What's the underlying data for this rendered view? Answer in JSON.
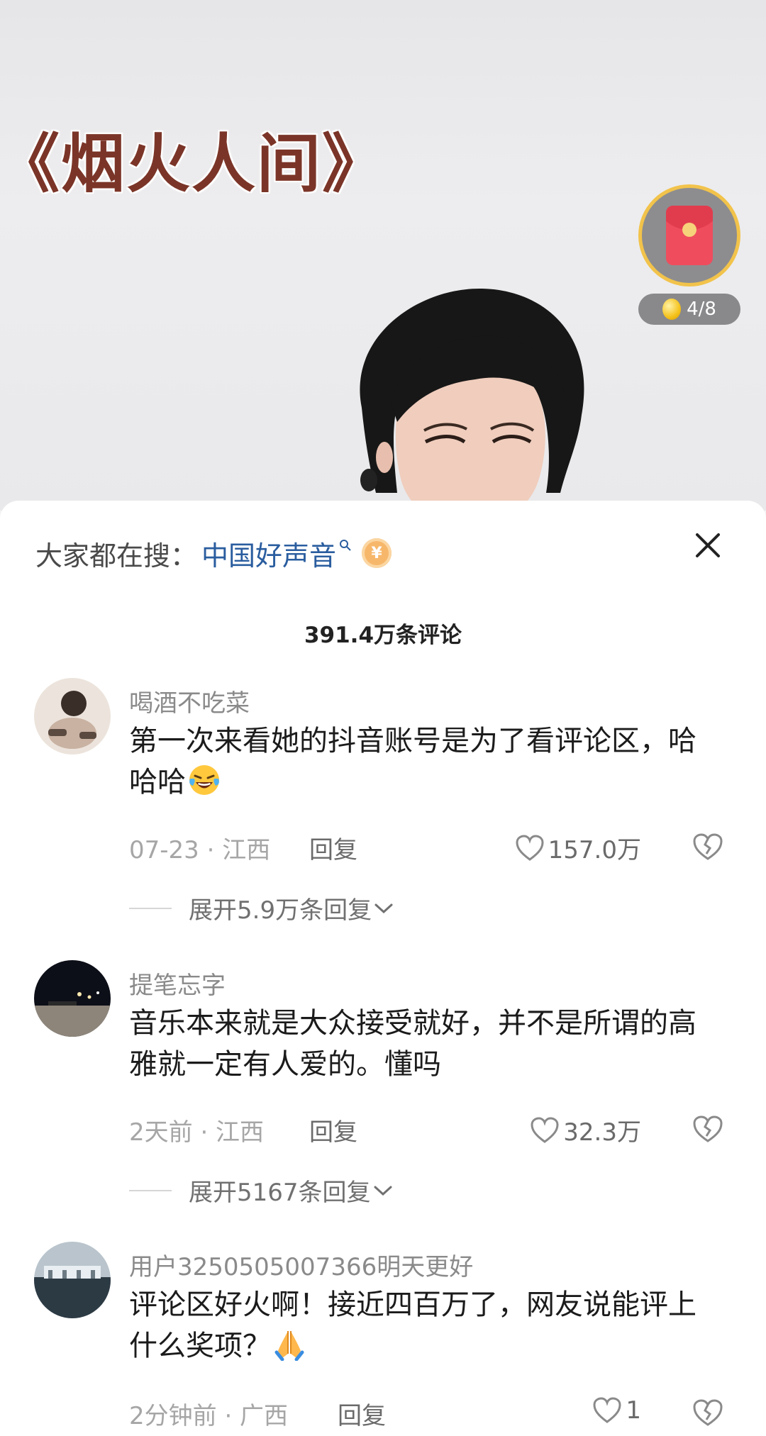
{
  "video": {
    "title_overlay": "《烟火人间》",
    "task_progress": "4/8"
  },
  "sheet": {
    "hot_search_label": "大家都在搜：",
    "hot_search_term": "中国好声音",
    "comment_count": "391.4万条评论"
  },
  "comments": [
    {
      "username": "喝酒不吃菜",
      "text": "第一次来看她的抖音账号是为了看评论区，哈哈哈",
      "emoji": "laughing-tears-emoji",
      "meta": "07-23 · 江西",
      "reply_label": "回复",
      "likes": "157.0万",
      "expand_label": "展开5.9万条回复"
    },
    {
      "username": "提笔忘字",
      "text": "音乐本来就是大众接受就好，并不是所谓的高雅就一定有人爱的。懂吗",
      "meta": "2天前 · 江西",
      "reply_label": "回复",
      "likes": "32.3万",
      "expand_label": "展开5167条回复"
    },
    {
      "username": "用户3250505007366明天更好",
      "text": "评论区好火啊！接近四百万了，网友说能评上什么奖项？",
      "emoji": "praying-hands-emoji",
      "meta": "2分钟前 · 广西",
      "reply_label": "回复",
      "likes": "1"
    }
  ],
  "colors": {
    "link_blue": "#2a5d9f",
    "title_red": "#7b3528",
    "red_packet": "#ef4d5e"
  }
}
